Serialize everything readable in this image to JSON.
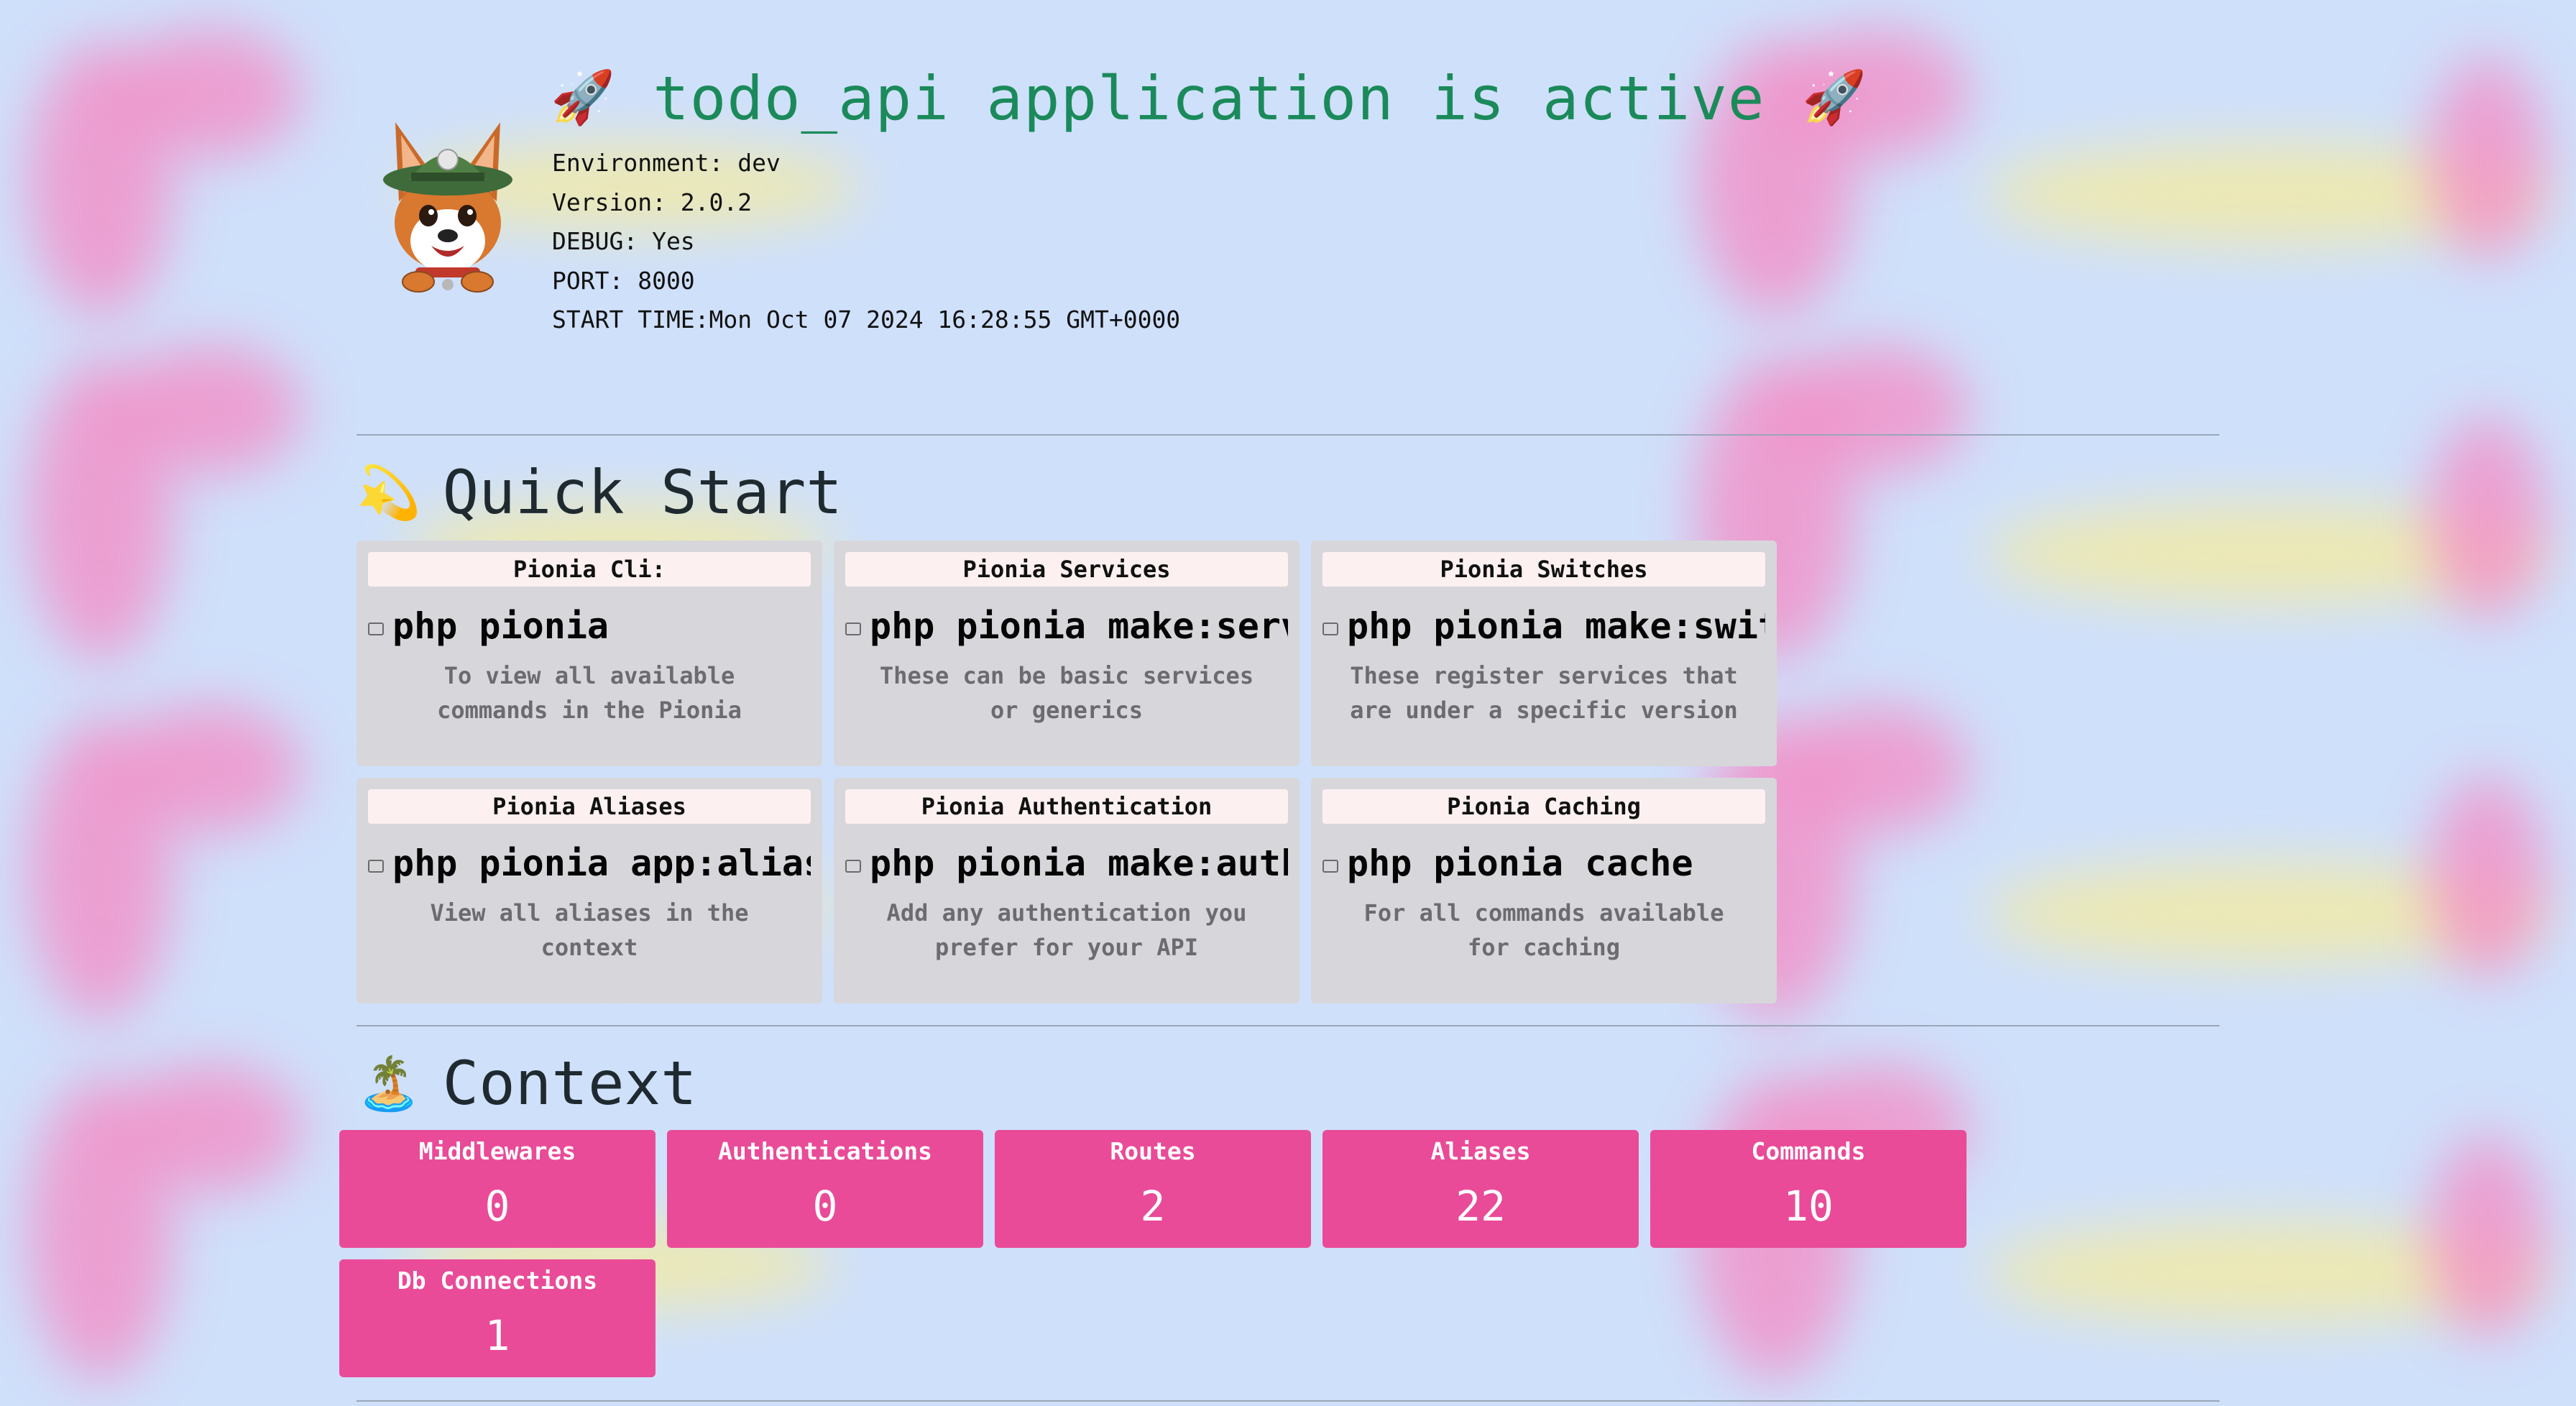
{
  "header": {
    "title": "todo_api application is active",
    "rocket_icon": "rocket-icon",
    "mascot": "dog-mascot-logo",
    "info": [
      "Environment: dev",
      "Version: 2.0.2",
      "DEBUG: Yes",
      "PORT: 8000",
      "START TIME:Mon Oct 07 2024 16:28:55 GMT+0000"
    ]
  },
  "quick_start": {
    "title": "Quick Start",
    "icon": "dizzy-star-icon",
    "cards": [
      {
        "label": "Pionia Cli:",
        "command": "php pionia",
        "description": "To view all available commands in the Pionia"
      },
      {
        "label": "Pionia Services",
        "command": "php pionia make:serv",
        "description": "These can be basic services or generics"
      },
      {
        "label": "Pionia Switches",
        "command": "php pionia make:swit",
        "description": "These register services that are under a specific version"
      },
      {
        "label": "Pionia Aliases",
        "command": "php pionia app:alias",
        "description": "View all aliases in the context"
      },
      {
        "label": "Pionia Authentication",
        "command": "php pionia make:auth",
        "description": "Add any authentication you prefer for your API"
      },
      {
        "label": "Pionia Caching",
        "command": "php pionia cache",
        "description": "For all commands available for caching"
      }
    ]
  },
  "context": {
    "title": "Context",
    "icon": "island-icon",
    "stats": [
      {
        "label": "Middlewares",
        "value": "0"
      },
      {
        "label": "Authentications",
        "value": "0"
      },
      {
        "label": "Routes",
        "value": "2"
      },
      {
        "label": "Aliases",
        "value": "22"
      },
      {
        "label": "Commands",
        "value": "10"
      },
      {
        "label": "Db Connections",
        "value": "1"
      }
    ]
  },
  "colors": {
    "background": "#cfe0fb",
    "title_green": "#1b8a5a",
    "card_gray": "#d7d7db",
    "stat_pink": "#e94b98"
  }
}
